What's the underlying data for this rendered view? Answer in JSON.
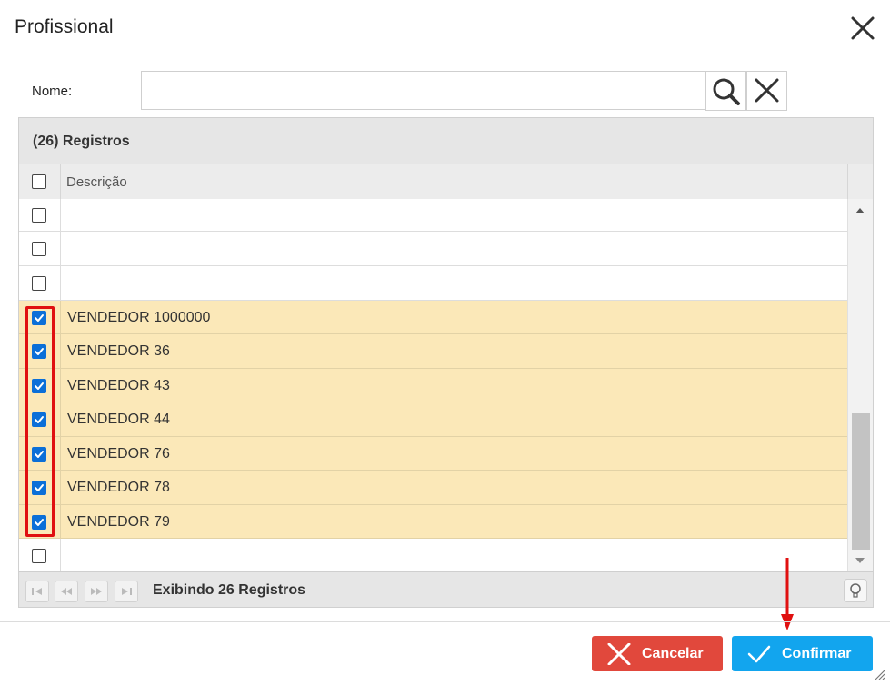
{
  "dialog": {
    "title": "Profissional"
  },
  "filter": {
    "label": "Nome:",
    "value": "",
    "placeholder": ""
  },
  "grid": {
    "caption": "(26) Registros",
    "column_header": "Descrição",
    "rows": [
      {
        "label": "",
        "checked": false
      },
      {
        "label": "",
        "checked": false
      },
      {
        "label": "",
        "checked": false
      },
      {
        "label": "VENDEDOR 1000000",
        "checked": true
      },
      {
        "label": "VENDEDOR 36",
        "checked": true
      },
      {
        "label": "VENDEDOR 43",
        "checked": true
      },
      {
        "label": "VENDEDOR 44",
        "checked": true
      },
      {
        "label": "VENDEDOR 76",
        "checked": true
      },
      {
        "label": "VENDEDOR 78",
        "checked": true
      },
      {
        "label": "VENDEDOR 79",
        "checked": true
      },
      {
        "label": "",
        "checked": false
      }
    ],
    "pager_info": "Exibindo 26 Registros"
  },
  "footer": {
    "cancel_label": "Cancelar",
    "confirm_label": "Confirmar"
  },
  "colors": {
    "selected_row": "#fbe8b8",
    "cancel": "#e1483c",
    "confirm": "#12a5ee",
    "annotation": "#e01010",
    "checkbox": "#0b6fd8"
  }
}
